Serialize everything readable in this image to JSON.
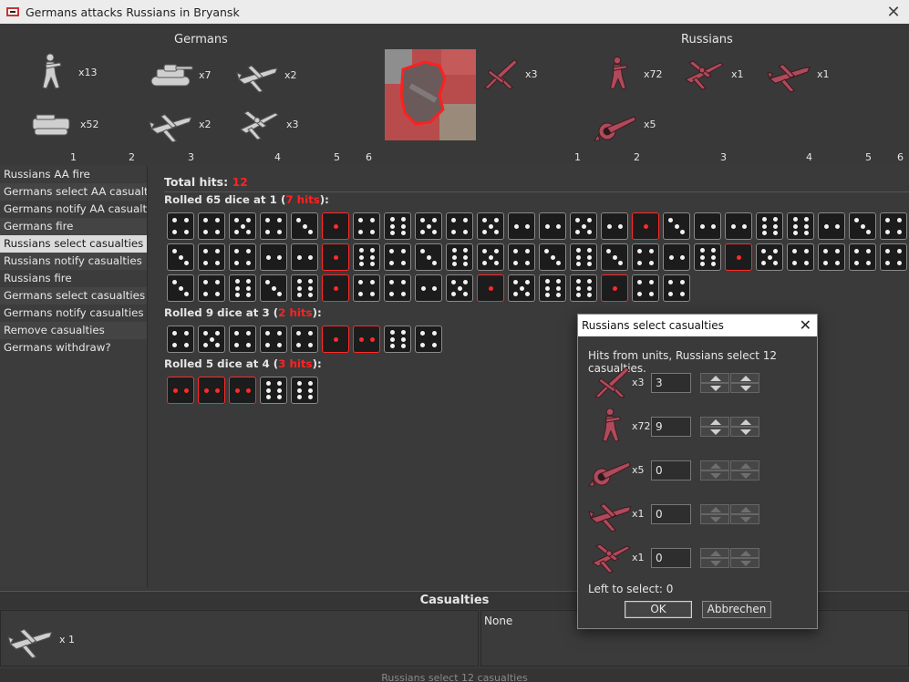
{
  "window": {
    "title": "Germans attacks Russians in Bryansk"
  },
  "header": {
    "attacker_title": "Germans",
    "defender_title": "Russians",
    "attacker_units": [
      {
        "icon": "infantry-icon",
        "count": "x13"
      },
      {
        "icon": "tank-icon",
        "count": "x7"
      },
      {
        "icon": "fighter-icon",
        "count": "x2"
      },
      {
        "icon": "halftrack-icon",
        "count": "x52"
      },
      {
        "icon": "fighter-icon",
        "count": "x2"
      },
      {
        "icon": "bomber-icon",
        "count": "x3"
      }
    ],
    "defender_units": [
      {
        "icon": "aa-gun-icon",
        "count": "x3"
      },
      {
        "icon": "infantry-icon",
        "count": "x72"
      },
      {
        "icon": "bomber-icon",
        "count": "x1"
      },
      {
        "icon": "fighter-icon",
        "count": "x1"
      },
      {
        "icon": "artillery-icon",
        "count": "x5"
      }
    ],
    "attacker_axis": [
      "1",
      "2",
      "3",
      "4",
      "5",
      "6"
    ],
    "defender_axis": [
      "1",
      "2",
      "3",
      "4",
      "5",
      "6"
    ]
  },
  "steps": [
    "Russians AA fire",
    "Germans select AA casualties",
    "Germans notify AA casualties",
    "Germans fire",
    "Russians select casualties",
    "Russians notify casualties",
    "Russians fire",
    "Germans select casualties",
    "Germans notify casualties",
    "Remove casualties",
    "Germans withdraw?"
  ],
  "active_step_index": 4,
  "total_hits": {
    "label": "Total hits: ",
    "value": "12"
  },
  "rolls": [
    {
      "prefix": "Rolled 65 dice at 1 (",
      "hits": "7 hits",
      "suffix": "):",
      "dice": [
        4,
        4,
        5,
        4,
        3,
        1,
        4,
        6,
        5,
        4,
        5,
        2,
        2,
        5,
        2,
        1,
        3,
        2,
        2,
        6,
        6,
        2,
        3,
        4,
        3,
        4,
        4,
        2,
        2,
        1,
        6,
        4,
        3,
        6,
        5,
        4,
        3,
        6,
        3,
        4,
        2,
        6,
        1,
        5,
        4,
        4,
        4,
        4,
        3,
        4,
        6,
        3,
        6,
        1,
        4,
        4,
        2,
        5,
        1,
        5,
        6,
        6,
        1,
        4,
        4
      ]
    },
    {
      "prefix": "Rolled 9 dice at 3 (",
      "hits": "2 hits",
      "suffix": "):",
      "dice": [
        4,
        5,
        4,
        4,
        4,
        1,
        2,
        6,
        4
      ]
    },
    {
      "prefix": "Rolled 5 dice at 4 (",
      "hits": "3 hits",
      "suffix": "):",
      "dice": [
        2,
        2,
        2,
        6,
        6
      ]
    }
  ],
  "hit_threshold": [
    1,
    3,
    4
  ],
  "casualties": {
    "title": "Casualties",
    "left_units": [
      {
        "icon": "fighter-icon",
        "count": "x 1"
      }
    ],
    "right_text": "None"
  },
  "status_bar": "Russians select 12 casualties",
  "dialog": {
    "title": "Russians select casualties",
    "message": "Hits from units,  Russians select 12 casualties.",
    "rows": [
      {
        "icon": "aa-gun-icon",
        "count": "x3",
        "value": "3"
      },
      {
        "icon": "infantry-icon",
        "count": "x72",
        "value": "9"
      },
      {
        "icon": "artillery-icon",
        "count": "x5",
        "value": "0"
      },
      {
        "icon": "fighter-icon",
        "count": "x1",
        "value": "0"
      },
      {
        "icon": "bomber-icon",
        "count": "x1",
        "value": "0"
      }
    ],
    "left_to_select": "Left to select: 0",
    "ok_label": "OK",
    "cancel_label": "Abbrechen"
  },
  "colors": {
    "hit": "#ff2a2a",
    "background": "#3a3a3a",
    "russian_unit": "#b04a5a",
    "german_unit": "#cfcfcf"
  }
}
